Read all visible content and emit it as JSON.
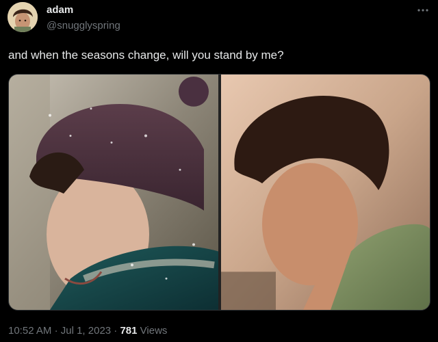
{
  "author": {
    "name": "adam",
    "handle": "@snugglyspring"
  },
  "tweet": {
    "text": "and when the seasons change, will you stand by me?"
  },
  "meta": {
    "time": "10:52 AM",
    "separator": "·",
    "date": "Jul 1, 2023",
    "views_count": "781",
    "views_label": "Views"
  },
  "icons": {
    "more": "more-horizontal-icon"
  },
  "colors": {
    "background": "#000000",
    "text_primary": "#e7e9ea",
    "text_secondary": "#71767b"
  }
}
